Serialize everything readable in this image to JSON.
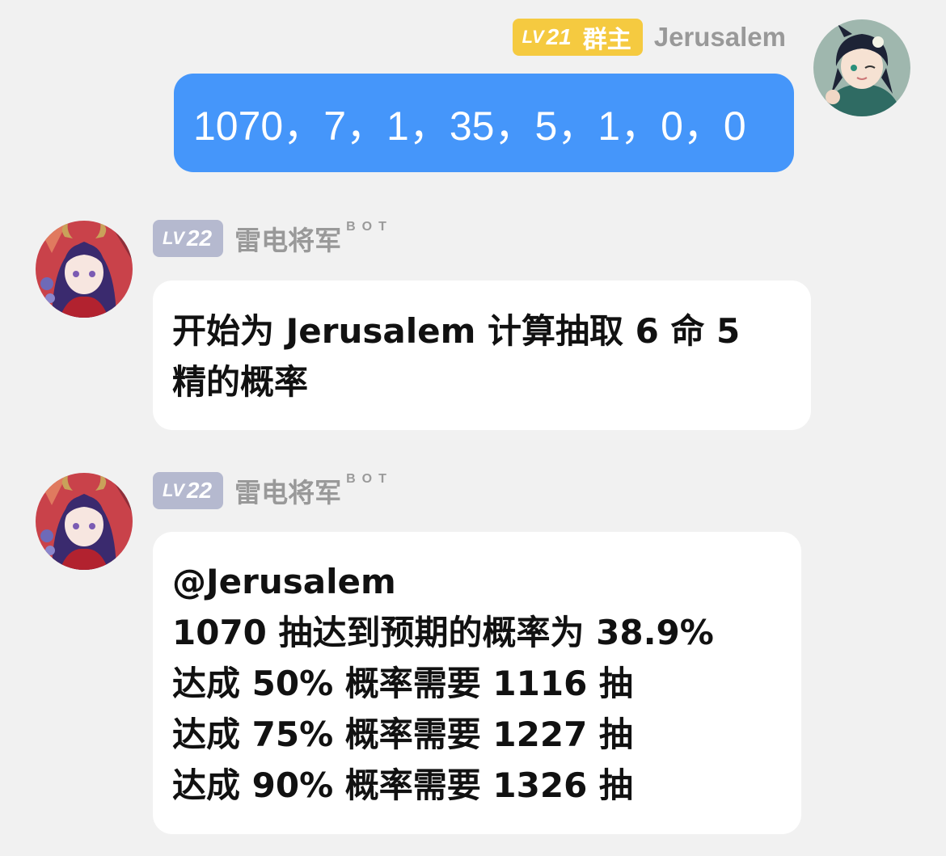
{
  "messages": [
    {
      "sender": "Jerusalem",
      "level": "21",
      "level_prefix": "LV",
      "role": "群主",
      "direction": "outgoing",
      "text": "1070，7，1，35，5，1，0，0"
    },
    {
      "sender": "雷电将军",
      "level": "22",
      "level_prefix": "LV",
      "tag": "BOT",
      "direction": "incoming",
      "lines": [
        "开始为 Jerusalem 计算抽取 6 命 5",
        "精的概率"
      ]
    },
    {
      "sender": "雷电将军",
      "level": "22",
      "level_prefix": "LV",
      "tag": "BOT",
      "direction": "incoming",
      "lines": [
        "@Jerusalem",
        "1070 抽达到预期的概率为 38.9%",
        "达成 50% 概率需要 1116 抽",
        "达成 75% 概率需要 1227 抽",
        "达成 90% 概率需要 1326 抽"
      ]
    }
  ],
  "colors": {
    "background": "#f1f1f1",
    "outgoing_bubble": "#4596fa",
    "incoming_bubble": "#ffffff",
    "owner_badge": "#f5ca40",
    "bot_level_badge": "#b5b9cf",
    "name_text": "#999999"
  },
  "icons": {
    "user_avatar": "user-avatar-icon",
    "bot_avatar": "bot-avatar-icon"
  }
}
